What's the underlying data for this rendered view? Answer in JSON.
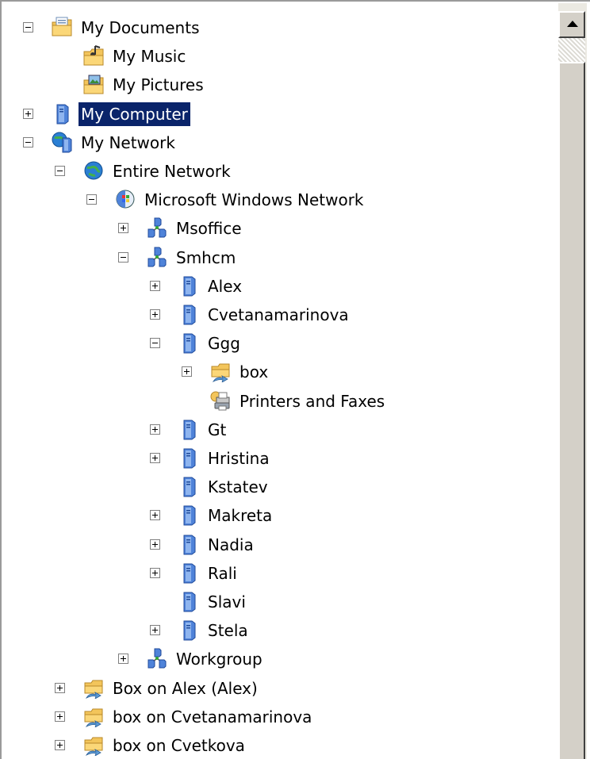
{
  "tree": {
    "items": [
      {
        "label": "My Documents",
        "level": 0,
        "expander": "minus",
        "icon": "documents-folder-icon"
      },
      {
        "label": "My Music",
        "level": 1,
        "expander": "none",
        "icon": "music-folder-icon"
      },
      {
        "label": "My Pictures",
        "level": 1,
        "expander": "none",
        "icon": "pictures-folder-icon"
      },
      {
        "label": "My Computer",
        "level": 0,
        "expander": "plus",
        "icon": "computer-icon",
        "selected": true
      },
      {
        "label": "My Network",
        "level": 0,
        "expander": "minus",
        "icon": "network-places-icon"
      },
      {
        "label": "Entire Network",
        "level": 1,
        "expander": "minus",
        "icon": "globe-icon"
      },
      {
        "label": "Microsoft Windows Network",
        "level": 2,
        "expander": "minus",
        "icon": "windows-network-icon"
      },
      {
        "label": "Msoffice",
        "level": 3,
        "expander": "plus",
        "icon": "workgroup-icon"
      },
      {
        "label": "Smhcm",
        "level": 3,
        "expander": "minus",
        "icon": "workgroup-icon"
      },
      {
        "label": "Alex",
        "level": 4,
        "expander": "plus",
        "icon": "computer-icon"
      },
      {
        "label": "Cvetanamarinova",
        "level": 4,
        "expander": "plus",
        "icon": "computer-icon"
      },
      {
        "label": "Ggg",
        "level": 4,
        "expander": "minus",
        "icon": "computer-icon"
      },
      {
        "label": "box",
        "level": 5,
        "expander": "plus",
        "icon": "shared-folder-icon"
      },
      {
        "label": "Printers and Faxes",
        "level": 5,
        "expander": "none",
        "icon": "printer-icon"
      },
      {
        "label": "Gt",
        "level": 4,
        "expander": "plus",
        "icon": "computer-icon"
      },
      {
        "label": "Hristina",
        "level": 4,
        "expander": "plus",
        "icon": "computer-icon"
      },
      {
        "label": "Kstatev",
        "level": 4,
        "expander": "none",
        "icon": "computer-icon"
      },
      {
        "label": "Makreta",
        "level": 4,
        "expander": "plus",
        "icon": "computer-icon"
      },
      {
        "label": "Nadia",
        "level": 4,
        "expander": "plus",
        "icon": "computer-icon"
      },
      {
        "label": "Rali",
        "level": 4,
        "expander": "plus",
        "icon": "computer-icon"
      },
      {
        "label": "Slavi",
        "level": 4,
        "expander": "none",
        "icon": "computer-icon"
      },
      {
        "label": "Stela",
        "level": 4,
        "expander": "plus",
        "icon": "computer-icon"
      },
      {
        "label": "Workgroup",
        "level": 3,
        "expander": "plus",
        "icon": "workgroup-icon"
      },
      {
        "label": "Box on Alex (Alex)",
        "level": 1,
        "expander": "plus",
        "icon": "shared-folder-icon"
      },
      {
        "label": "box on Cvetanamarinova",
        "level": 1,
        "expander": "plus",
        "icon": "shared-folder-icon"
      },
      {
        "label": "box on Cvetkova",
        "level": 1,
        "expander": "plus",
        "icon": "shared-folder-icon"
      },
      {
        "label": "",
        "level": 1,
        "expander": "none",
        "icon": "shared-folder-icon"
      }
    ]
  },
  "colors": {
    "selection_background": "#0a246a",
    "selection_text": "#ffffff",
    "window_background": "#ffffff",
    "scrollbar_face": "#d4d0c8"
  }
}
